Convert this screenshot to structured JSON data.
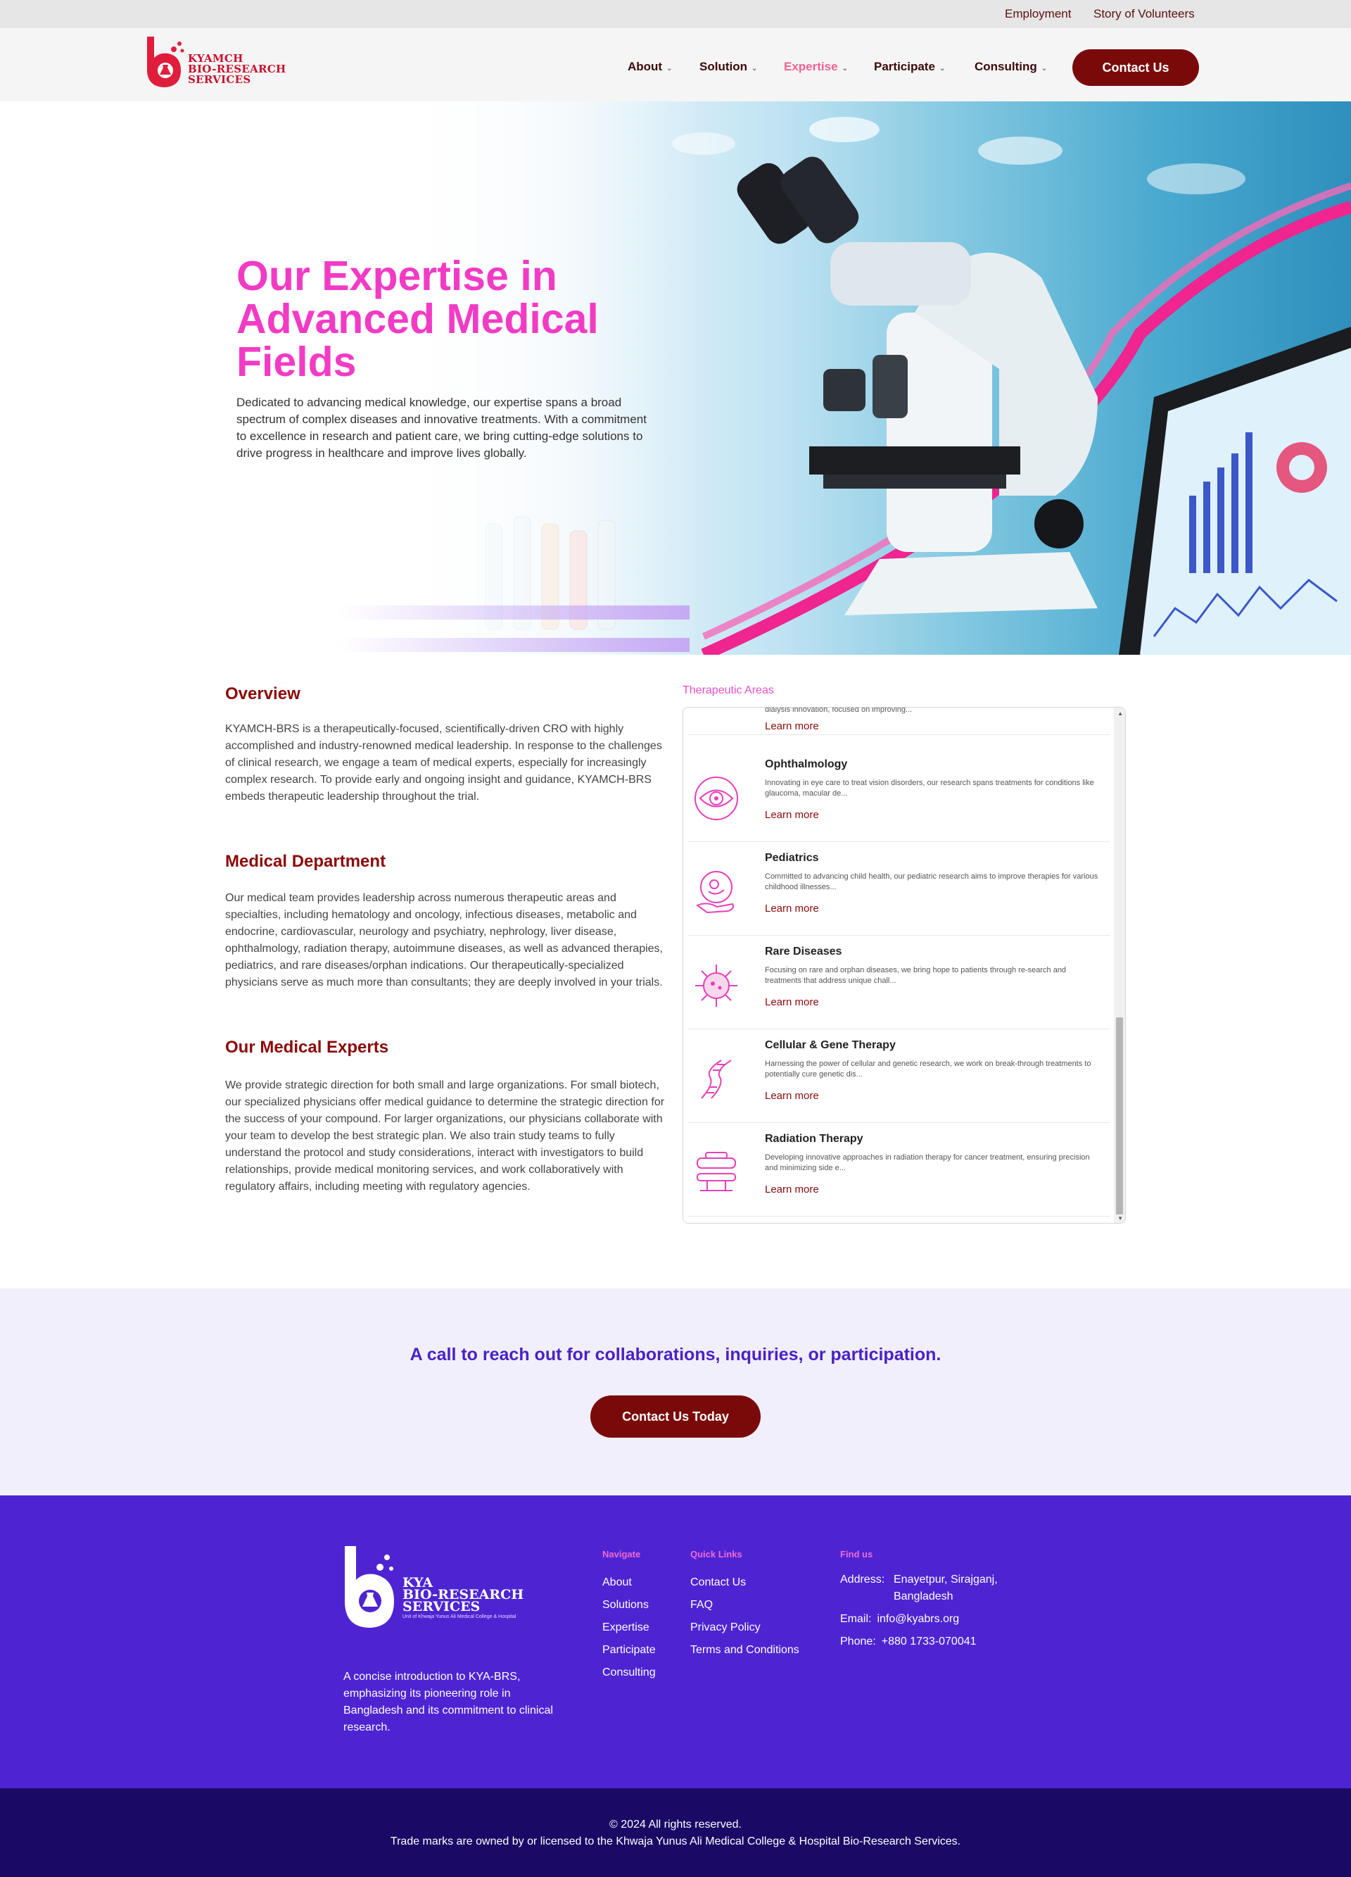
{
  "topbar": {
    "employment": "Employment",
    "volunteers": "Story of Volunteers"
  },
  "header": {
    "logo_text": [
      "KYAMCH",
      "BIO-RESEARCH",
      "SERVICES"
    ],
    "nav": [
      {
        "label": "About",
        "active": false
      },
      {
        "label": "Solution",
        "active": false
      },
      {
        "label": "Expertise",
        "active": true
      },
      {
        "label": "Participate",
        "active": false
      },
      {
        "label": "Consulting",
        "active": false
      }
    ],
    "contact_label": "Contact Us"
  },
  "hero": {
    "title": "Our Expertise in Advanced Medical Fields",
    "description": "Dedicated to advancing medical knowledge, our expertise spans a broad spectrum of complex diseases and innovative treatments. With a commitment to excellence in research and patient care, we bring cutting-edge solutions to drive progress in healthcare and improve lives globally."
  },
  "overview": {
    "heading": "Overview",
    "text": "KYAMCH-BRS is a therapeutically-focused, scientifically-driven CRO with highly accomplished and industry-renowned medical leadership. In response to the challenges of clinical research, we engage a team of medical experts, especially for increasingly complex research. To provide early and ongoing insight and guidance, KYAMCH-BRS embeds therapeutic leadership throughout the trial."
  },
  "medical_department": {
    "heading": "Medical Department",
    "text": "Our medical team provides leadership across numerous therapeutic areas and specialties, including hematology and oncology, infectious diseases, metabolic and endocrine, cardiovascular, neurology and psychiatry, nephrology, liver disease, ophthalmology, radiation therapy, autoimmune diseases, as well as advanced therapies, pediatrics, and rare diseases/orphan indications. Our therapeutically-specialized physicians serve as much more than consultants; they are deeply involved in your trials."
  },
  "medical_experts": {
    "heading": "Our Medical Experts",
    "text": "We provide strategic direction for both small and large organizations. For small biotech, our specialized physicians offer medical guidance to determine the strategic direction for the success of your compound. For larger organizations, our physicians collaborate with your team to develop the best strategic plan. We also train study teams to fully understand the protocol and study considerations, interact with investigators to build relationships, provide medical monitoring services, and work collaboratively with regulatory affairs, including meeting with regulatory agencies."
  },
  "therapeutic": {
    "label": "Therapeutic Areas",
    "partial_text": "dialysis innovation, focused on improving...",
    "learn_more": "Learn more",
    "items": [
      {
        "title": "Ophthalmology",
        "icon": "eye-icon",
        "desc": "Innovating in eye care to treat vision disorders, our research spans treatments for conditions like glaucoma, macular de..."
      },
      {
        "title": "Pediatrics",
        "icon": "baby-hand-icon",
        "desc": "Committed to advancing child health, our pediatric research aims to improve therapies for various childhood illnesses..."
      },
      {
        "title": "Rare Diseases",
        "icon": "virus-icon",
        "desc": "Focusing on rare and orphan diseases, we bring hope to patients through re-search and treatments that address unique chall..."
      },
      {
        "title": "Cellular & Gene Therapy",
        "icon": "dna-icon",
        "desc": "Harnessing the power of cellular and genetic research, we work on break-through treatments to potentially cure genetic dis..."
      },
      {
        "title": "Radiation Therapy",
        "icon": "radiation-machine-icon",
        "desc": "Developing innovative approaches in radiation therapy for cancer treatment, ensuring precision and minimizing side e..."
      }
    ]
  },
  "cta": {
    "text": "A call to reach out for collaborations, inquiries, or participation.",
    "button": "Contact Us Today"
  },
  "footer": {
    "logo_text": [
      "KYA",
      "BIO-RESEARCH",
      "SERVICES"
    ],
    "logo_sub": "Unit of Khwaja Yunus Ali Medical College & Hospital",
    "description": "A concise introduction to KYA-BRS, emphasizing its pioneering role in Bangladesh and its commitment to clinical research.",
    "navigate": {
      "heading": "Navigate",
      "links": [
        "About",
        "Solutions",
        "Expertise",
        "Participate",
        "Consulting"
      ]
    },
    "quick_links": {
      "heading": "Quick Links",
      "links": [
        "Contact Us",
        "FAQ",
        "Privacy Policy",
        "Terms and Conditions"
      ]
    },
    "find_us": {
      "heading": "Find us",
      "address_label": "Address:",
      "address": "Enayetpur, Sirajganj, Bangladesh",
      "email_label": "Email:",
      "email": "info@kyabrs.org",
      "phone_label": "Phone:",
      "phone": "+880 1733-070041"
    },
    "copyright": "© 2024 All rights reserved.",
    "trademark": "Trade marks are owned by or licensed to the Khwaja Yunus Ali Medical College & Hospital Bio-Research Services."
  },
  "colors": {
    "brand_red": "#7a0a0a",
    "accent_pink": "#f23bc5",
    "footer_purple": "#4e24d2",
    "copyright_bg": "#1a0a66"
  }
}
